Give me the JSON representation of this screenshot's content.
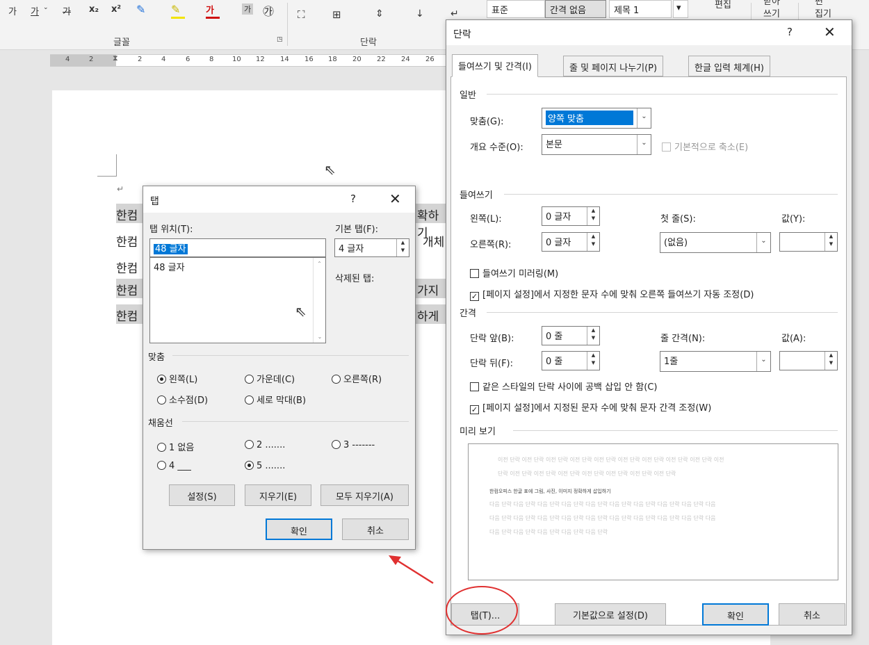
{
  "ribbon": {
    "font_row": [
      "가",
      "가",
      "가",
      "x₂",
      "x²"
    ],
    "font_group": "글꼴",
    "para_group": "단락",
    "styles": [
      "표준",
      "간격 없음",
      "제목 1"
    ],
    "edit_label": "편집",
    "receive_label": "받아\n쓰기",
    "editor_label": "편\n집기"
  },
  "ruler": [
    "4",
    "2",
    "2",
    "4",
    "6",
    "8",
    "10",
    "12",
    "14",
    "16",
    "18",
    "20",
    "22",
    "24",
    "26"
  ],
  "doc": {
    "lines_left": [
      "한컴",
      "한컴",
      "한컴",
      "한컴",
      "한컴"
    ],
    "lines_right": [
      "확하기",
      "개체",
      "",
      "가지",
      "하게"
    ]
  },
  "tab_dialog": {
    "title": "탭",
    "help": "?",
    "tab_pos_label": "탭 위치(T):",
    "tab_pos_value": "48 글자",
    "list_items": [
      "48 글자"
    ],
    "default_tab_label": "기본 탭(F):",
    "default_tab_value": "4 글자",
    "deleted_label": "삭제된 탭:",
    "align_group": "맞춤",
    "align_options": [
      "왼쪽(L)",
      "가운데(C)",
      "오른쪽(R)",
      "소수점(D)",
      "세로 막대(B)"
    ],
    "leader_group": "채움선",
    "leader_options": [
      "1 없음",
      "2 .......",
      "3 -------",
      "4 ___",
      "5 ......."
    ],
    "set_btn": "설정(S)",
    "clear_btn": "지우기(E)",
    "clear_all_btn": "모두 지우기(A)",
    "ok_btn": "확인",
    "cancel_btn": "취소"
  },
  "para_dialog": {
    "title": "단락",
    "help": "?",
    "tabs": [
      "들여쓰기 및 간격(I)",
      "줄 및 페이지 나누기(P)",
      "한글 입력 체계(H)"
    ],
    "general_group": "일반",
    "align_label": "맞춤(G):",
    "align_value": "양쪽 맞춤",
    "outline_label": "개요 수준(O):",
    "outline_value": "본문",
    "collapse_label": "기본적으로 축소(E)",
    "indent_group": "들여쓰기",
    "left_label": "왼쪽(L):",
    "left_value": "0 글자",
    "right_label": "오른쪽(R):",
    "right_value": "0 글자",
    "first_line_label": "첫 줄(S):",
    "first_line_value": "(없음)",
    "value_label": "값(Y):",
    "mirror_label": "들여쓰기 미러링(M)",
    "auto_right_label": "[페이지 설정]에서 지정한 문자 수에 맞춰 오른쪽 들여쓰기 자동 조정(D)",
    "spacing_group": "간격",
    "before_label": "단락 앞(B):",
    "before_value": "0 줄",
    "after_label": "단락 뒤(F):",
    "after_value": "0 줄",
    "line_spacing_label": "줄 간격(N):",
    "line_spacing_value": "1줄",
    "at_label": "값(A):",
    "no_space_label": "같은 스타일의 단락 사이에 공백 삽입 안 함(C)",
    "grid_label": "[페이지 설정]에서 지정된 문자 수에 맞춰 문자 간격 조정(W)",
    "preview_group": "미리 보기",
    "preview_prev": "이전 단락 이전 단락 이전 단락 이전 단락 이전 단락 이전 단락 이전 단락 이전 단락 이전 단락 이전",
    "preview_prev2": "단락 이전 단락 이전 단락 이전 단락 이전 단락 이전 단락 이전 단락 이전 단락",
    "preview_cur": "한컴오피스 한글 표에 그림, 사진, 이미지 정확하게 삽입하기",
    "preview_next": "다음 단락 다음 단락 다음 단락 다음 단락 다음 단락 다음 단락 다음 단락 다음 단락 다음 단락 다음",
    "preview_next_last": "다음 단락 다음 단락 다음 단락 다음 단락 다음 단락",
    "tabs_btn": "탭(T)...",
    "default_btn": "기본값으로 설정(D)",
    "ok_btn": "확인",
    "cancel_btn": "취소"
  },
  "colors": {
    "accent": "#0078d7",
    "highlight": "#0078d7",
    "arrow": "#e03030"
  }
}
